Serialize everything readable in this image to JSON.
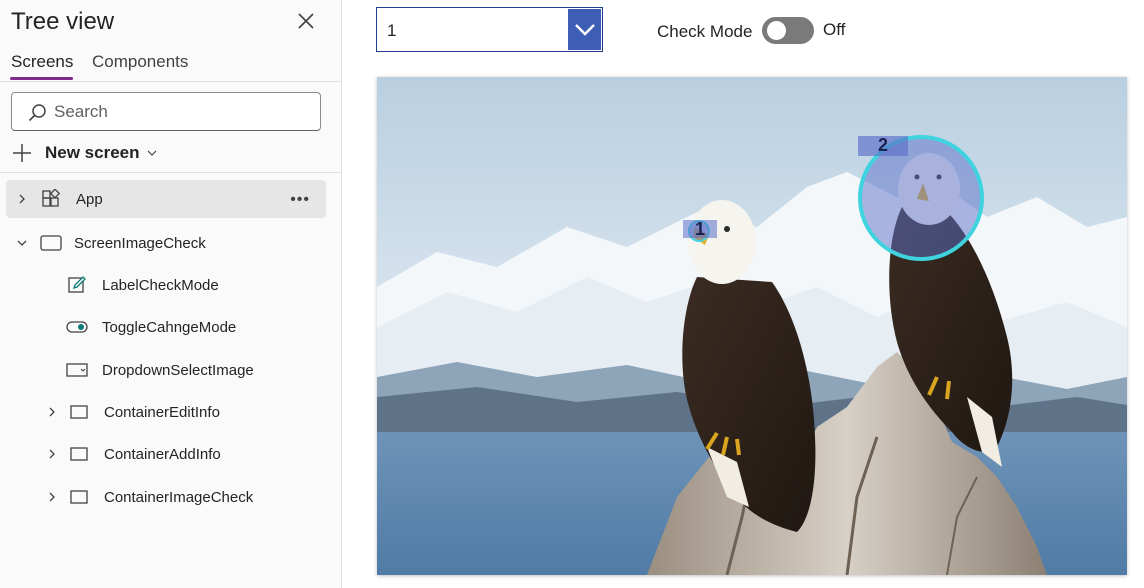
{
  "tree_panel": {
    "title": "Tree view",
    "tabs": [
      {
        "label": "Screens",
        "active": true
      },
      {
        "label": "Components",
        "active": false
      }
    ],
    "search": {
      "placeholder": "Search",
      "value": ""
    },
    "new_screen_label": "New screen",
    "items": [
      {
        "label": "App",
        "icon": "app-components-icon",
        "expander": "collapsed",
        "selected": true
      },
      {
        "label": "ScreenImageCheck",
        "icon": "screen-icon",
        "expander": "expanded",
        "selected": false
      },
      {
        "label": "LabelCheckMode",
        "icon": "label-edit-icon",
        "expander": "none",
        "selected": false
      },
      {
        "label": "ToggleCahngeMode",
        "icon": "toggle-icon",
        "expander": "none",
        "selected": false
      },
      {
        "label": "DropdownSelectImage",
        "icon": "dropdown-icon",
        "expander": "none",
        "selected": false
      },
      {
        "label": "ContainerEditInfo",
        "icon": "container-icon",
        "expander": "collapsed",
        "selected": false
      },
      {
        "label": "ContainerAddInfo",
        "icon": "container-icon",
        "expander": "collapsed",
        "selected": false
      },
      {
        "label": "ContainerImageCheck",
        "icon": "container-icon",
        "expander": "collapsed",
        "selected": false
      }
    ]
  },
  "canvas": {
    "dropdown": {
      "selected_value": "1"
    },
    "check_mode": {
      "label": "Check Mode",
      "state_text": "Off",
      "on": false
    },
    "image": {
      "subject": "two bald eagles on driftwood, snowy mountains background",
      "markers": [
        {
          "label": "1",
          "shape": "small circle"
        },
        {
          "label": "2",
          "shape": "large circle"
        }
      ]
    }
  },
  "colors": {
    "tab_accent": "#7e2a8b",
    "dropdown_border": "#203c8f",
    "dropdown_button": "#3e5db5",
    "toggle_off": "#7a7a7a",
    "marker_ring": "#3fd3e0",
    "marker_fill": "#5b6fc9"
  }
}
